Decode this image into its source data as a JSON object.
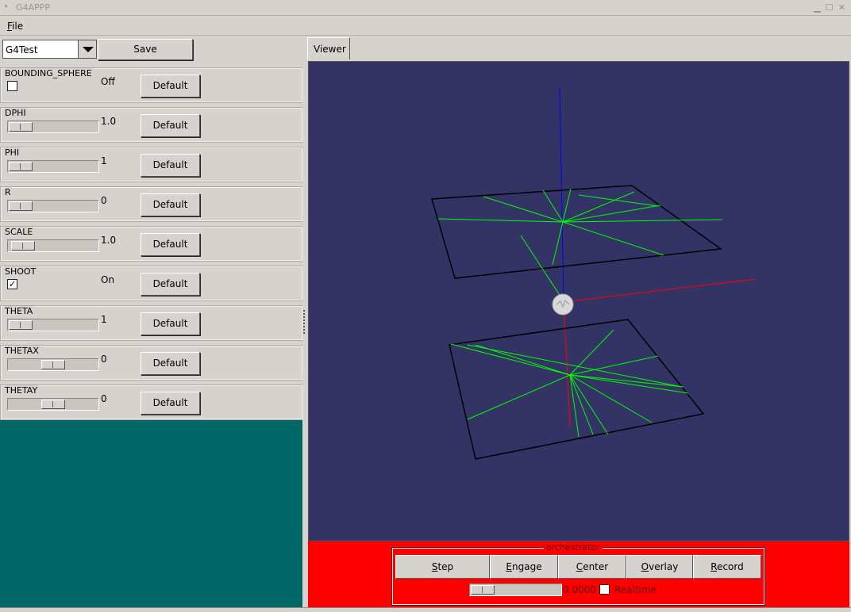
{
  "window": {
    "title": "G4APPP"
  },
  "menu": {
    "file_prefix": "F",
    "file_rest": "ile"
  },
  "toolbar": {
    "combo_value": "G4Test",
    "save_label": "Save"
  },
  "params": [
    {
      "name": "BOUNDING_SPHERE",
      "kind": "checkbox",
      "checked": false,
      "value": "Off",
      "default_label": "Default"
    },
    {
      "name": "DPHI",
      "kind": "slider",
      "value": "1.0",
      "default_label": "Default"
    },
    {
      "name": "PHI",
      "kind": "slider",
      "value": "1",
      "default_label": "Default"
    },
    {
      "name": "R",
      "kind": "slider",
      "value": "0",
      "default_label": "Default"
    },
    {
      "name": "SCALE",
      "kind": "slider",
      "value": "1.0",
      "default_label": "Default"
    },
    {
      "name": "SHOOT",
      "kind": "checkbox",
      "checked": true,
      "value": "On",
      "default_label": "Default"
    },
    {
      "name": "THETA",
      "kind": "slider",
      "value": "1",
      "default_label": "Default"
    },
    {
      "name": "THETAX",
      "kind": "slider",
      "value": "0",
      "default_label": "Default"
    },
    {
      "name": "THETAY",
      "kind": "slider",
      "value": "0",
      "default_label": "Default"
    }
  ],
  "viewer": {
    "tab_label": "Viewer",
    "background": "#333366",
    "axis_colors": {
      "x": "#ff0000",
      "y": "#0000ff",
      "z": "#ff0000"
    },
    "track_color": "#00ff00"
  },
  "orchestrator": {
    "title": "orchestrator",
    "buttons": [
      {
        "prefix": "S",
        "rest": "tep"
      },
      {
        "prefix": "E",
        "rest": "ngage"
      },
      {
        "prefix": "C",
        "rest": "enter"
      },
      {
        "prefix": "O",
        "rest": "verlay"
      },
      {
        "prefix": "R",
        "rest": "ecord"
      }
    ],
    "time_value": "0.0000",
    "realtime_label": "Realtime",
    "realtime_checked": false,
    "panel_color": "#ff0000"
  }
}
